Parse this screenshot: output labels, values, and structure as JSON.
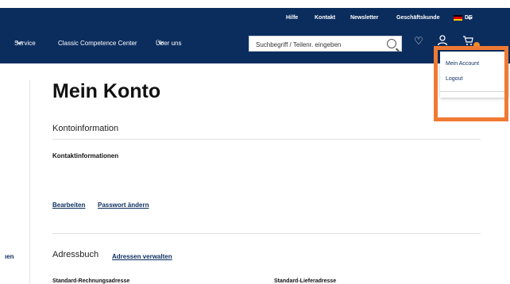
{
  "header": {
    "top_links": [
      "Hilfe",
      "Kontakt",
      "Newsletter",
      "Geschäftskunde"
    ],
    "language": "DE",
    "nav": [
      "Service",
      "Classic Competence Center",
      "Über uns"
    ],
    "search_placeholder": "Suchbegriff / Teilenr. eingeben",
    "icons": [
      "wishlist-heart-icon",
      "account-user-icon",
      "cart-icon"
    ],
    "colors": {
      "header_bg": "#0b2d5e",
      "accent": "#f08a2d",
      "highlight": "#f07a33"
    }
  },
  "account_dropdown": {
    "items": [
      "Mein Account",
      "Logout"
    ]
  },
  "sidebar": {
    "partial_label": "ıen"
  },
  "main": {
    "title": "Mein Konto",
    "section_title": "Kontoinformation",
    "contact_heading": "Kontaktinformationen",
    "edit_link": "Bearbeiten",
    "password_link": "Passwort ändern",
    "address_title": "Adressbuch",
    "manage_addresses_link": "Adressen verwalten",
    "cut_off_left": "Standard-Rechnungsadresse",
    "cut_off_right": "Standard-Lieferadresse"
  }
}
